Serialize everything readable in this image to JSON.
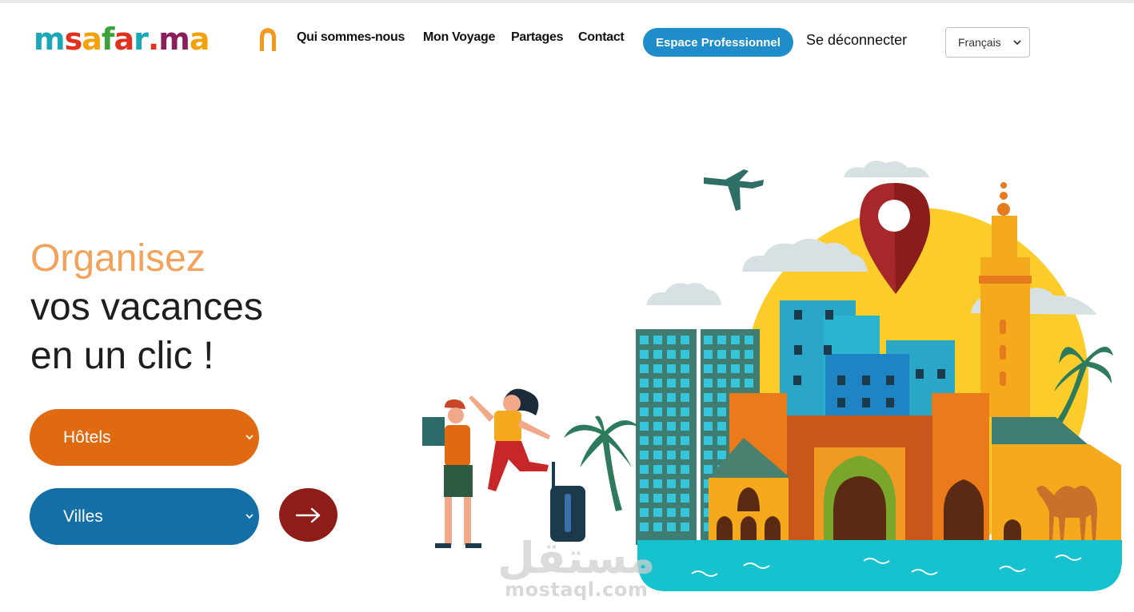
{
  "header": {
    "logo": {
      "parts": [
        "m",
        "s",
        "a",
        "f",
        "a",
        "r",
        ".",
        "m",
        "a"
      ],
      "colors": [
        "#1aa8b8",
        "#e0321e",
        "#f4a20c",
        "#3ca33b",
        "#e0321e",
        "#1aa8b8",
        "#e0321e",
        "#8a1d5c",
        "#f4a20c"
      ]
    },
    "nav": [
      {
        "label": "Qui sommes-nous"
      },
      {
        "label": "Mon Voyage"
      },
      {
        "label": "Partages"
      },
      {
        "label": "Contact"
      }
    ],
    "pro_button": "Espace Professionnel",
    "logout": "Se déconnecter",
    "language": {
      "selected": "Français"
    }
  },
  "hero": {
    "line1": "Organisez",
    "line2": "vos vacances",
    "line3": "en un clic !",
    "hotels_select": "Hôtels",
    "cities_select": "Villes",
    "go_icon": "arrow-right-icon"
  },
  "watermark": {
    "arabic": "مستقل",
    "latin": "mostaql.com"
  },
  "colors": {
    "accent_orange": "#e06a12",
    "accent_blue": "#136fa6",
    "pro_blue": "#1f8dc9",
    "go_red": "#8e1c19",
    "title_orange": "#f2a25a"
  }
}
